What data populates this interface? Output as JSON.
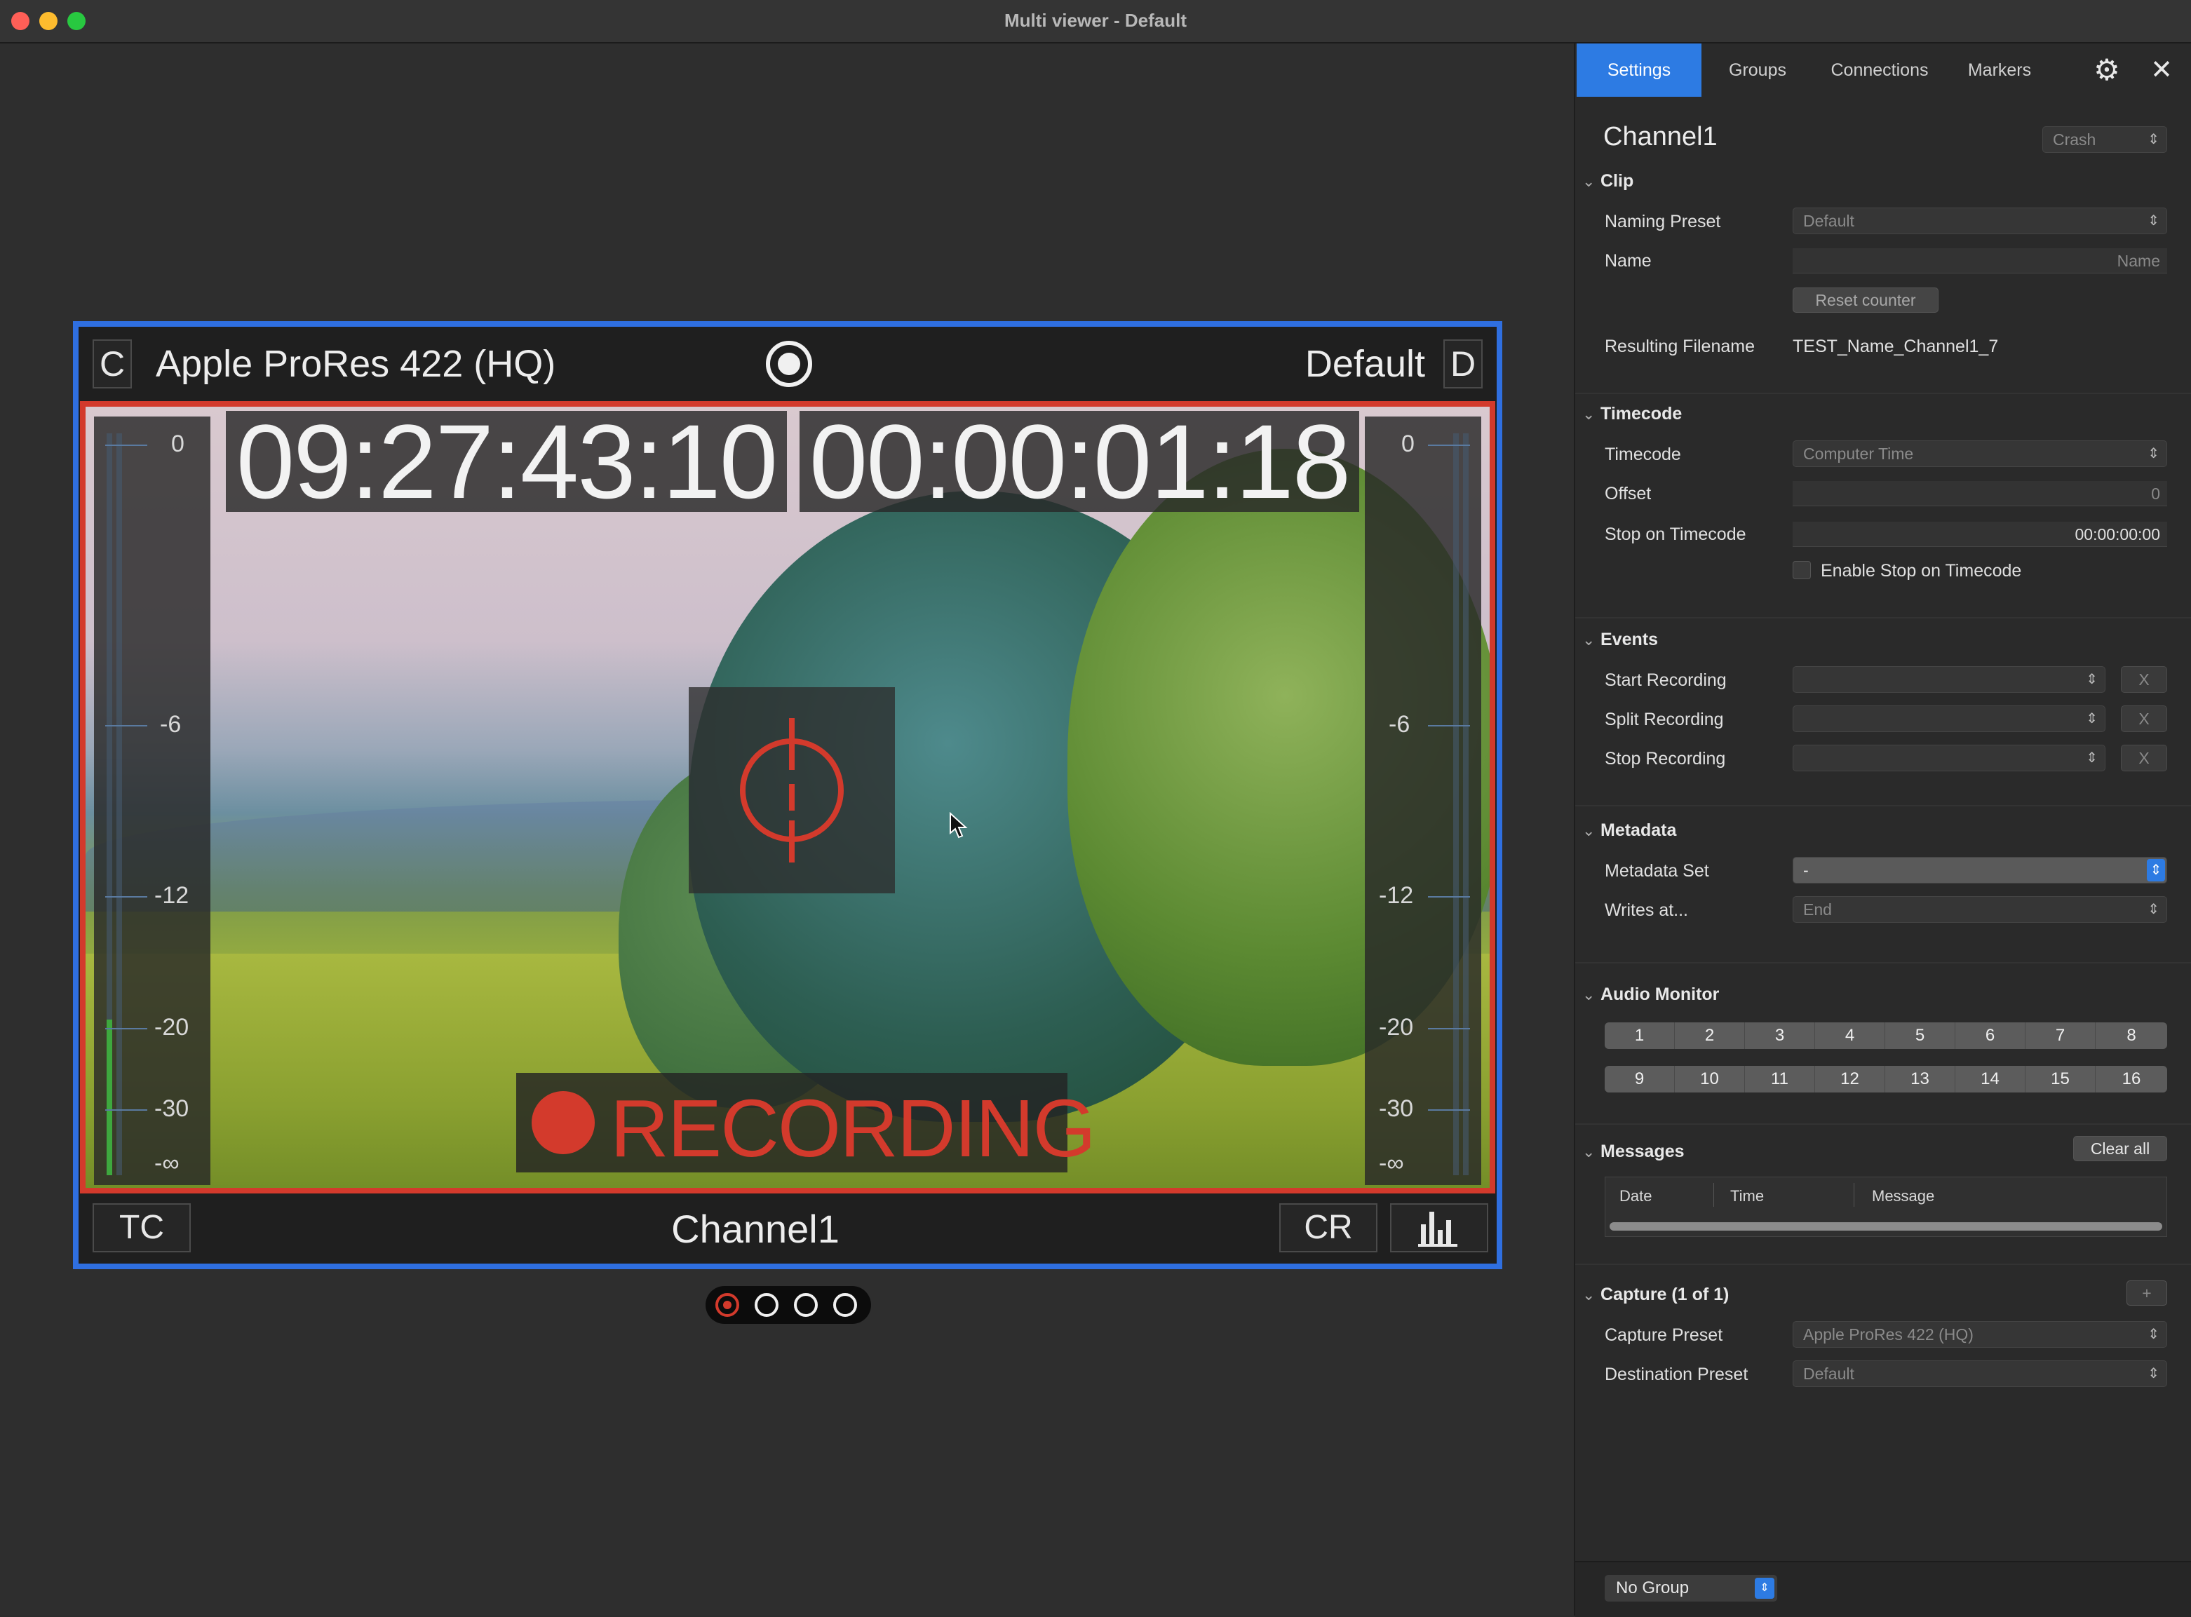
{
  "window": {
    "title": "Multi viewer - Default"
  },
  "viewer": {
    "left_button": "C",
    "codec": "Apple ProRes 422 (HQ)",
    "preset": "Default",
    "right_button": "D",
    "timecode_1": "09:27:43:10",
    "timecode_2": "00:00:01:18",
    "recording_label": "RECORDING",
    "channel_name": "Channel1",
    "tc_button": "TC",
    "cr_button": "CR",
    "meter_scale": [
      "0",
      "-6",
      "-12",
      "-20",
      "-30",
      "-∞"
    ],
    "accent_color": "#2f6fe0",
    "record_color": "#d33a2c"
  },
  "pager": {
    "pages": 4,
    "active": 1
  },
  "panel": {
    "tabs": [
      "Settings",
      "Groups",
      "Connections",
      "Markers"
    ],
    "active_tab": "Settings",
    "channel_title": "Channel1",
    "channel_mode": "Crash",
    "clip": {
      "title": "Clip",
      "naming_preset_label": "Naming Preset",
      "naming_preset_value": "Default",
      "name_label": "Name",
      "name_placeholder": "Name",
      "reset_counter": "Reset counter",
      "resulting_filename_label": "Resulting Filename",
      "resulting_filename_value": "TEST_Name_Channel1_7"
    },
    "timecode": {
      "title": "Timecode",
      "timecode_label": "Timecode",
      "timecode_value": "Computer Time",
      "offset_label": "Offset",
      "offset_value": "0",
      "stop_label": "Stop on Timecode",
      "stop_value": "00:00:00:00",
      "enable_stop_label": "Enable Stop on Timecode"
    },
    "events": {
      "title": "Events",
      "start_label": "Start Recording",
      "split_label": "Split Recording",
      "stop_label": "Stop Recording",
      "clear_label": "X"
    },
    "metadata": {
      "title": "Metadata",
      "set_label": "Metadata Set",
      "set_value": "-",
      "writes_label": "Writes at...",
      "writes_value": "End"
    },
    "audio_monitor": {
      "title": "Audio Monitor",
      "row1": [
        "1",
        "2",
        "3",
        "4",
        "5",
        "6",
        "7",
        "8"
      ],
      "row2": [
        "9",
        "10",
        "11",
        "12",
        "13",
        "14",
        "15",
        "16"
      ]
    },
    "messages": {
      "title": "Messages",
      "clear_all": "Clear all",
      "columns": [
        "Date",
        "Time",
        "Message"
      ]
    },
    "capture": {
      "title": "Capture (1 of 1)",
      "add_label": "+",
      "preset_label": "Capture Preset",
      "preset_value": "Apple ProRes 422 (HQ)",
      "destination_label": "Destination Preset",
      "destination_value": "Default"
    },
    "footer": {
      "group_value": "No Group"
    }
  }
}
